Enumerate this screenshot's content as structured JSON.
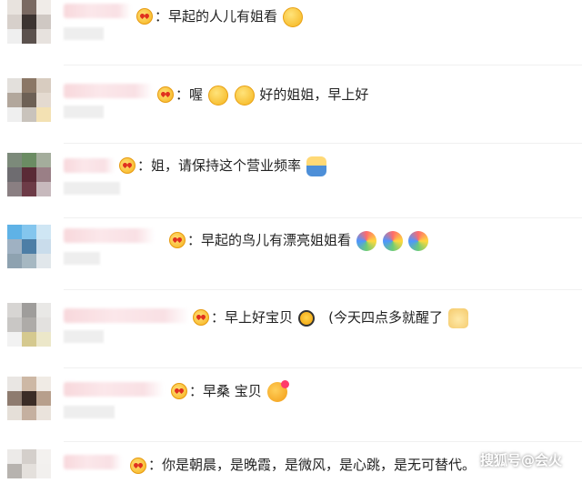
{
  "comments": [
    {
      "text": "早起的人儿有姐看",
      "avatar": [
        "#e8e3de",
        "#7a6a62",
        "#f0ece8",
        "#d7d0cb",
        "#3c3431",
        "#cfc8c3",
        "#efefef",
        "#5b514d",
        "#e7e2de"
      ]
    },
    {
      "text": "喔",
      "text2": "好的姐姐，早上好",
      "avatar": [
        "#e3e0dc",
        "#8b7766",
        "#d8ccc0",
        "#b2a79c",
        "#6d6055",
        "#e4dad0",
        "#efefef",
        "#c9c3bc",
        "#f3e1b3"
      ]
    },
    {
      "text": "姐，请保持这个营业频率",
      "avatar": [
        "#7c8a7a",
        "#6b8c63",
        "#a4ad9c",
        "#6e6c70",
        "#5a2a36",
        "#9a7f86",
        "#8a7f82",
        "#6d3b47",
        "#c7b9bd"
      ]
    },
    {
      "text": "早起的鸟儿有漂亮姐姐看",
      "avatar": [
        "#5fb2e6",
        "#84c6ee",
        "#cfe6f4",
        "#9fb1c2",
        "#4d7ea6",
        "#c9dceb",
        "#8ea2b0",
        "#a6b8c2",
        "#e1e7eb"
      ]
    },
    {
      "text": "早上好宝贝",
      "text2": "(今天四点多就醒了",
      "avatar": [
        "#d7d5d3",
        "#9f9d9b",
        "#e9e8e6",
        "#c9c7c5",
        "#aeaba8",
        "#e3e1df",
        "#f2f2f2",
        "#d5c98f",
        "#ece7c9"
      ]
    },
    {
      "text": "早桑 宝贝",
      "avatar": [
        "#e9e6e3",
        "#cdb8a5",
        "#f0ebe5",
        "#8e7b6f",
        "#3b2c26",
        "#b79f8c",
        "#e5dfd8",
        "#c5b0a0",
        "#eae3dc"
      ]
    },
    {
      "text": "你是朝晨，是晚霞，是微风，是心跳，是无可替代。",
      "avatar": [
        "#eceae8",
        "#d4cfcb",
        "#f3f1ef",
        "#b7b3af",
        "#e4e0dc",
        "#f2f0ee",
        "#ffffff",
        "#ffffff",
        "#ffffff"
      ]
    }
  ],
  "watermark": "搜狐号@会火"
}
